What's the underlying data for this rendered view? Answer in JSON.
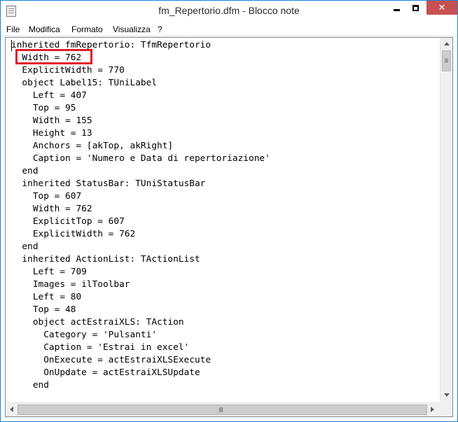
{
  "window": {
    "title": "fm_Repertorio.dfm - Blocco note",
    "controls": {
      "minimize": "minimize",
      "maximize": "maximize",
      "close": "✕"
    }
  },
  "menu": [
    "File",
    "Modifica",
    "Formato",
    "Visualizza",
    "?"
  ],
  "editor": {
    "lines": [
      "inherited fmRepertorio: TfmRepertorio",
      "  Width = 762",
      "  ExplicitWidth = 770",
      "  object Label15: TUniLabel",
      "    Left = 407",
      "    Top = 95",
      "    Width = 155",
      "    Height = 13",
      "    Anchors = [akTop, akRight]",
      "    Caption = 'Numero e Data di repertoriazione'",
      "  end",
      "  inherited StatusBar: TUniStatusBar",
      "    Top = 607",
      "    Width = 762",
      "    ExplicitTop = 607",
      "    ExplicitWidth = 762",
      "  end",
      "  inherited ActionList: TActionList",
      "    Left = 709",
      "    Images = ilToolbar",
      "    Left = 80",
      "    Top = 48",
      "    object actEstraiXLS: TAction",
      "      Category = 'Pulsanti'",
      "      Caption = 'Estrai in excel'",
      "      OnExecute = actEstraiXLSExecute",
      "      OnUpdate = actEstraiXLSUpdate",
      "    end"
    ],
    "highlight_color": "#e0202a"
  },
  "colors": {
    "window_border": "#1883d7",
    "close_button": "#c75050"
  }
}
